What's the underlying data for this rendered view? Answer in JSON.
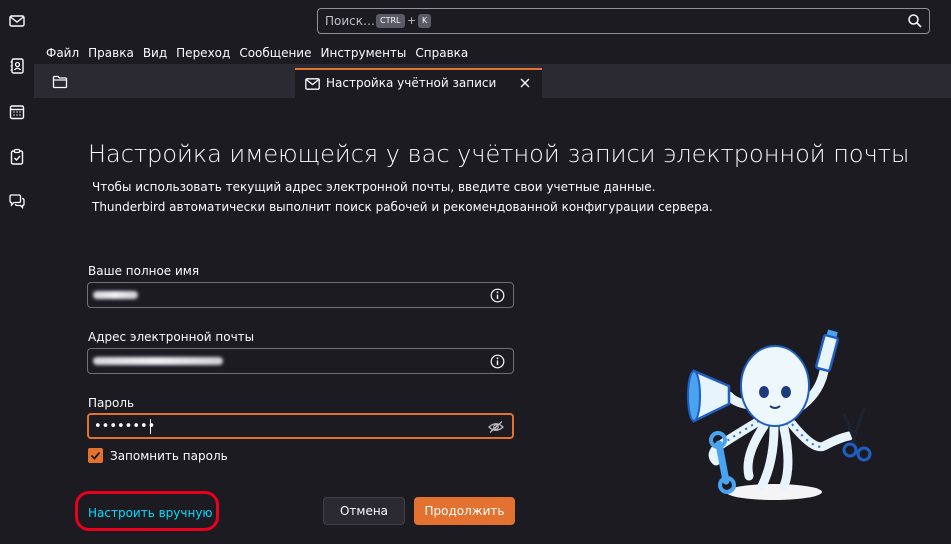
{
  "search": {
    "placeholder": "Поиск…",
    "key1": "CTRL",
    "plus": "+",
    "key2": "K"
  },
  "menu": [
    "Файл",
    "Правка",
    "Вид",
    "Переход",
    "Сообщение",
    "Инструменты",
    "Справка"
  ],
  "spaces": [
    "mail-icon",
    "address-book-icon",
    "calendar-icon",
    "tasks-icon",
    "chat-icon"
  ],
  "tab": {
    "label": "Настройка учётной записи"
  },
  "page": {
    "title": "Настройка имеющейся у вас учётной записи электронной почты",
    "desc1": "Чтобы использовать текущий адрес электронной почты, введите свои учетные данные.",
    "desc2": "Thunderbird автоматически выполнит поиск рабочей и рекомендованной конфигурации сервера."
  },
  "form": {
    "name_label": "Ваше полное имя",
    "email_label": "Адрес электронной почты",
    "password_label": "Пароль",
    "password_value": "••••••••",
    "remember_label": "Запомнить пароль",
    "remember_checked": true
  },
  "actions": {
    "manual": "Настроить вручную",
    "cancel": "Отмена",
    "continue": "Продолжить"
  },
  "colors": {
    "accent": "#e3712f",
    "link": "#00ddff",
    "annotation": "#e8001c",
    "background": "#1c1b22"
  }
}
